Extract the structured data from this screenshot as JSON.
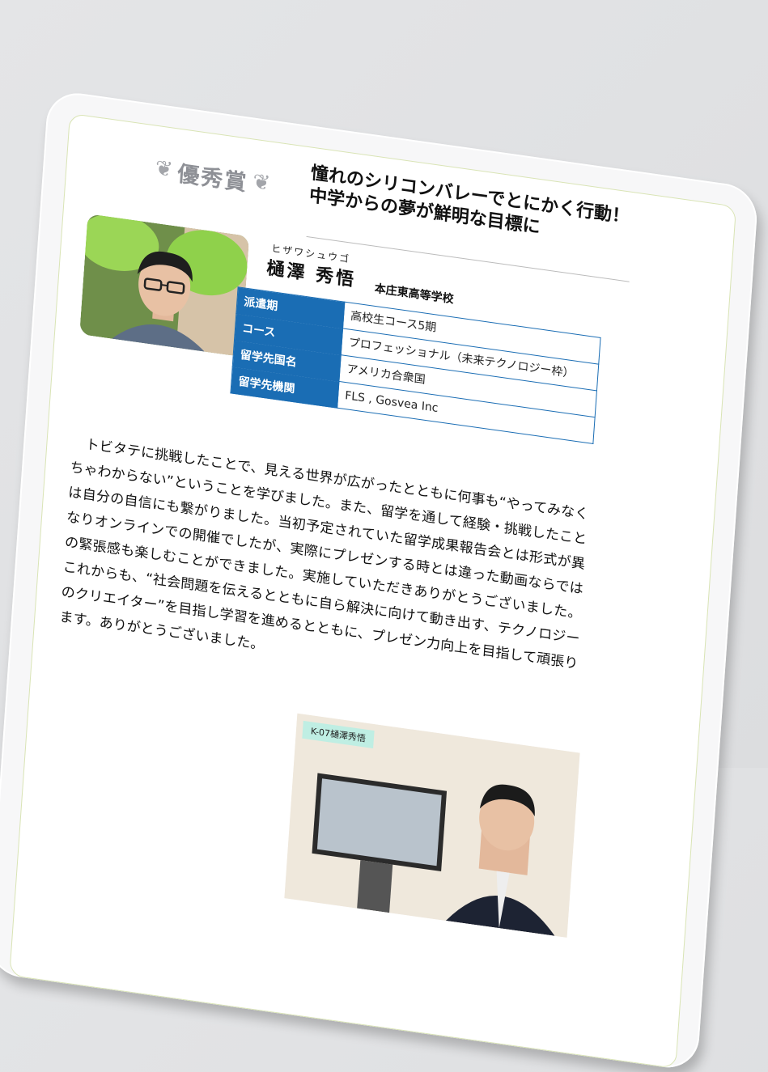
{
  "award": {
    "label": "優秀賞"
  },
  "headline": "憧れのシリコンバレーでとにかく行動！中学からの夢が鮮明な目標に",
  "student": {
    "furigana": "ヒザワシュウゴ",
    "name": "樋澤 秀悟",
    "school": "本庄東高等学校"
  },
  "info_rows": [
    {
      "label": "派遣期",
      "value": "高校生コース5期"
    },
    {
      "label": "コース",
      "value": "プロフェッショナル（未来テクノロジー枠）"
    },
    {
      "label": "留学先国名",
      "value": "アメリカ合衆国"
    },
    {
      "label": "留学先機関",
      "value": "FLS , Gosvea Inc"
    }
  ],
  "body": "トビタテに挑戦したことで、見える世界が広がったとともに何事も“やってみなくちゃわからない”ということを学びました。また、留学を通して経験・挑戦したことは自分の自信にも繋がりました。当初予定されていた留学成果報告会とは形式が異なりオンラインでの開催でしたが、実際にプレゼンする時とは違った動画ならではの緊張感も楽しむことができました。実施していただきありがとうございました。これからも、“社会問題を伝えるとともに自ら解決に向けて動き出す、テクノロジーのクリエイター”を目指し学習を進めるとともに、プレゼン力向上を目指して頑張ります。ありがとうございました。",
  "video": {
    "tag": "K-07樋澤秀悟"
  },
  "colors": {
    "table_header": "#1a6db4",
    "award_gray": "#8e9096"
  }
}
